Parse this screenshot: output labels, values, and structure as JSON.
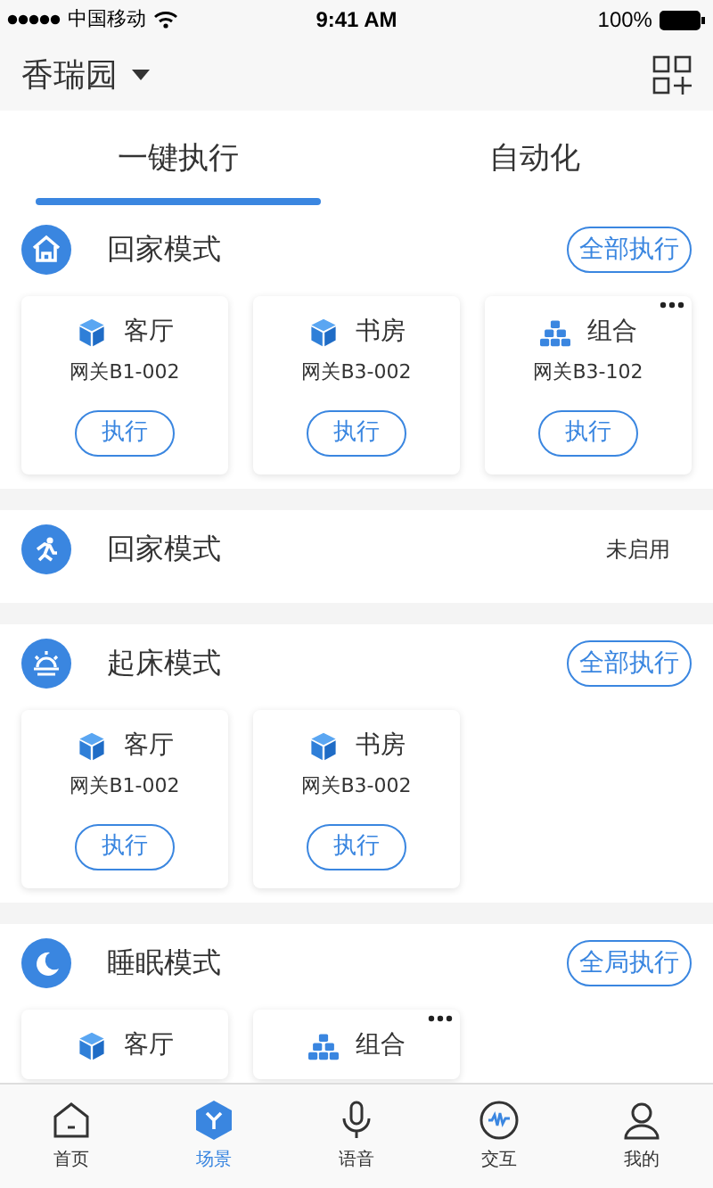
{
  "status_bar": {
    "carrier": "中国移动",
    "time": "9:41 AM",
    "battery": "100%"
  },
  "header": {
    "home": "香瑞园"
  },
  "tabs": [
    {
      "label": "一键执行",
      "selected": true
    },
    {
      "label": "自动化",
      "selected": false
    }
  ],
  "scenes": [
    {
      "kind": "home",
      "name": "回家模式",
      "action": "全部执行",
      "cards": [
        {
          "kind": "room",
          "name": "客厅",
          "gateway": "网关B1-002",
          "button": "执行"
        },
        {
          "kind": "room",
          "name": "书房",
          "gateway": "网关B3-002",
          "button": "执行"
        },
        {
          "kind": "combo",
          "name": "组合",
          "gateway": "网关B3-102",
          "button": "执行"
        }
      ]
    },
    {
      "kind": "run",
      "name": "回家模式",
      "status": "未启用"
    },
    {
      "kind": "sunrise",
      "name": "起床模式",
      "action": "全部执行",
      "cards": [
        {
          "kind": "room",
          "name": "客厅",
          "gateway": "网关B1-002",
          "button": "执行"
        },
        {
          "kind": "room",
          "name": "书房",
          "gateway": "网关B3-002",
          "button": "执行"
        }
      ]
    },
    {
      "kind": "moon",
      "name": "睡眠模式",
      "action": "全局执行",
      "cards": [
        {
          "kind": "room",
          "name": "客厅"
        },
        {
          "kind": "combo",
          "name": "组合"
        }
      ]
    }
  ],
  "tab_bar": [
    {
      "kind": "home",
      "label": "首页",
      "selected": false
    },
    {
      "kind": "scene",
      "label": "场景",
      "selected": true
    },
    {
      "kind": "mic",
      "label": "语音",
      "selected": false
    },
    {
      "kind": "chat",
      "label": "交互",
      "selected": false
    },
    {
      "kind": "user",
      "label": "我的",
      "selected": false
    }
  ]
}
